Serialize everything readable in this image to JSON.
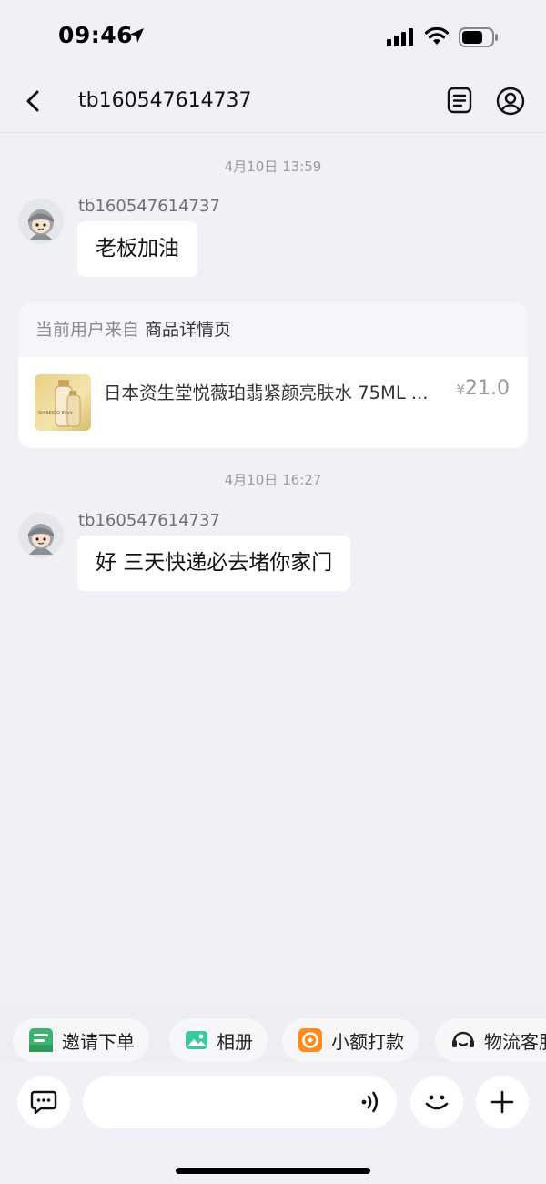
{
  "status_bar": {
    "time": "09:46"
  },
  "nav": {
    "title": "tb160547614737"
  },
  "messages": [
    {
      "timestamp": "4月10日 13:59",
      "sender": "tb160547614737",
      "text": "老板加油"
    },
    {
      "timestamp": "4月10日 16:27",
      "sender": "tb160547614737",
      "text": "好 三天快递必去堵你家门"
    }
  ],
  "product_card": {
    "source_label": "当前用户来自",
    "source_page": "商品详情页",
    "name": "日本资生堂悦薇珀翡紧颜亮肤水 75ML ...",
    "currency": "¥",
    "price": "21.0",
    "thumb_text": "SHISEIDO Elixir"
  },
  "quick_actions": [
    {
      "label": "邀请下单",
      "icon": "invite-order-icon",
      "color": "#3cb371"
    },
    {
      "label": "相册",
      "icon": "album-icon",
      "color": "#3cc8a0"
    },
    {
      "label": "小额打款",
      "icon": "small-payment-icon",
      "color": "#ff8a1f"
    },
    {
      "label": "物流客服",
      "icon": "logistics-service-icon",
      "color": "#222222"
    }
  ],
  "input": {
    "placeholder": ""
  },
  "colors": {
    "background": "#f0f1f6",
    "bubble": "#ffffff",
    "accent_orange": "#ff8a1f"
  }
}
